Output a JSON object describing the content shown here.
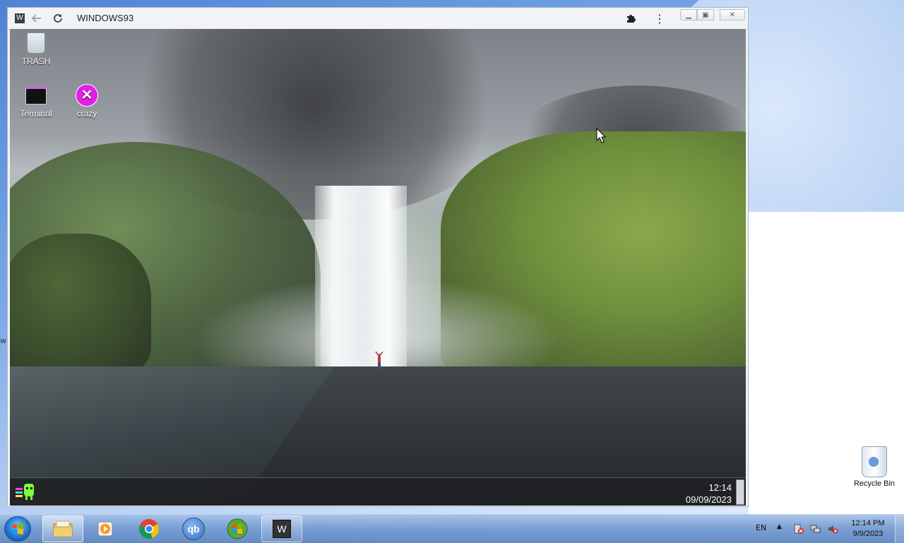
{
  "browser": {
    "title": "WINDOWS93",
    "favicon_letter": "W",
    "icons": [
      "back-arrow-icon",
      "reload-icon",
      "puzzle-icon",
      "kebab-menu-icon"
    ],
    "window_controls": [
      "minimize",
      "maximize",
      "close"
    ]
  },
  "w93": {
    "desktop_icons": [
      {
        "label": "TRASH",
        "icon": "trash-icon"
      },
      {
        "label": "Terminal",
        "icon": "terminal-icon"
      },
      {
        "label": "crazy",
        "icon": "crazy-icon"
      }
    ],
    "taskbar": {
      "time": "12:14",
      "date": "09/09/2023"
    }
  },
  "host": {
    "recycle_bin_label": "Recycle Bin",
    "taskbar": {
      "pinned": [
        "file-explorer-icon",
        "media-player-icon",
        "chrome-icon",
        "qbittorrent-icon",
        "windows-update-icon",
        "windows93-app-icon"
      ],
      "qb_label": "qb",
      "w_label": "W",
      "language": "EN",
      "time": "12:14 PM",
      "date": "9/9/2023"
    }
  },
  "colors": {
    "w93_accent": "#e020e6",
    "host_taskbar": "#6e96cd"
  }
}
